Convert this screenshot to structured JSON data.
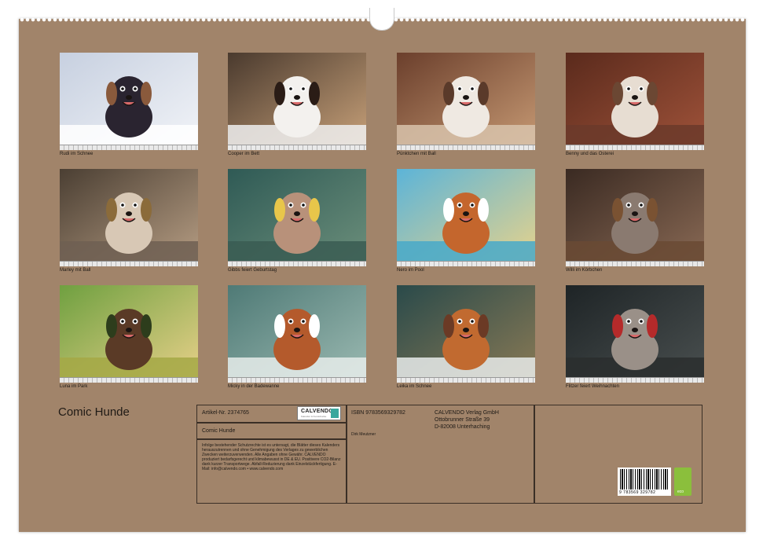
{
  "calendar_title": "Comic Hunde",
  "photos": [
    {
      "caption": "Rudi im Schnee",
      "palette": {
        "bg1": "#c7d0e0",
        "bg2": "#f2f4f8",
        "ground": "#ffffff",
        "dog": "#2a2430",
        "accent": "#8a5a3c"
      }
    },
    {
      "caption": "Cooper im Bett",
      "palette": {
        "bg1": "#4a3a2e",
        "bg2": "#c9a27a",
        "ground": "#eeeeee",
        "dog": "#f3f1ee",
        "accent": "#2a1c16"
      }
    },
    {
      "caption": "Pünktchen mit Ball",
      "palette": {
        "bg1": "#6b3f2c",
        "bg2": "#c79a74",
        "ground": "#d8c3ab",
        "dog": "#efe9e2",
        "accent": "#5a3a2a"
      }
    },
    {
      "caption": "Benny und das Osterei",
      "palette": {
        "bg1": "#5a2a1c",
        "bg2": "#a0533a",
        "ground": "#6b3a2a",
        "dog": "#e7ddd2",
        "accent": "#6b4733"
      }
    },
    {
      "caption": "Marley mit Ball",
      "palette": {
        "bg1": "#4b3f33",
        "bg2": "#b79e84",
        "ground": "#6e5f52",
        "dog": "#d8c8b5",
        "accent": "#8b6b3a"
      }
    },
    {
      "caption": "Gibbs feiert Geburtstag",
      "palette": {
        "bg1": "#2f5a55",
        "bg2": "#6c8f7b",
        "ground": "#3a5c52",
        "dog": "#b8917a",
        "accent": "#e8c64a"
      }
    },
    {
      "caption": "Nero im Pool",
      "palette": {
        "bg1": "#5cb4d8",
        "bg2": "#e9d38a",
        "ground": "#48a9c9",
        "dog": "#c4662d",
        "accent": "#ffffff"
      }
    },
    {
      "caption": "Willi im Körbchen",
      "palette": {
        "bg1": "#3a2a22",
        "bg2": "#8a6a55",
        "ground": "#6a4a34",
        "dog": "#8a7a70",
        "accent": "#7a5232"
      }
    },
    {
      "caption": "Luna im Park",
      "palette": {
        "bg1": "#6fa040",
        "bg2": "#e9d18a",
        "ground": "#a4a845",
        "dog": "#5a3a26",
        "accent": "#2d3d1c"
      }
    },
    {
      "caption": "Micky in der Badewanne",
      "palette": {
        "bg1": "#4f7a76",
        "bg2": "#9cbab2",
        "ground": "#e6ecea",
        "dog": "#b45a2c",
        "accent": "#ffffff"
      }
    },
    {
      "caption": "Leika im Schnee",
      "palette": {
        "bg1": "#2a4a4a",
        "bg2": "#8a7a55",
        "ground": "#e7ebea",
        "dog": "#c16a30",
        "accent": "#6b3a25"
      }
    },
    {
      "caption": "Flitzer feiert Weihnachten",
      "palette": {
        "bg1": "#1e2426",
        "bg2": "#4a5050",
        "ground": "#2a2e2e",
        "dog": "#9a9088",
        "accent": "#b52a2a"
      }
    }
  ],
  "info": {
    "article_no": "Artikel-Nr. 2374765",
    "title": "Comic Hunde",
    "legal": "Infolge bestehender Schutzrechte ist es untersagt, die Blätter dieses Kalenders herauszutrennen und ohne Genehmigung des Verlages zu gewerblichen Zwecken weiterzuverwenden. Alle Angaben ohne Gewähr. CALVENDO produziert bedarfsgerecht und klimabewusst in DE & EU. Positivere CO2-Bilanz dank kurzer Transportwege. Abfall-Reduzierung dank Einzelstückfertigung. E-Mail: info@calvendo.com • www.calvendo.com",
    "isbn": "ISBN 9783569329782",
    "author": "Dirk Meutzner",
    "publisher_line1": "CALVENDO Verlag GmbH",
    "publisher_line2": "Ottobrunner Straße 39",
    "publisher_line3": "D-82008 Unterhaching",
    "logo_name": "CALVENDO",
    "logo_sub": "Kalender & Kunstdrucke",
    "barcode_number": "9 783569 329782",
    "eco_label": "eco"
  }
}
